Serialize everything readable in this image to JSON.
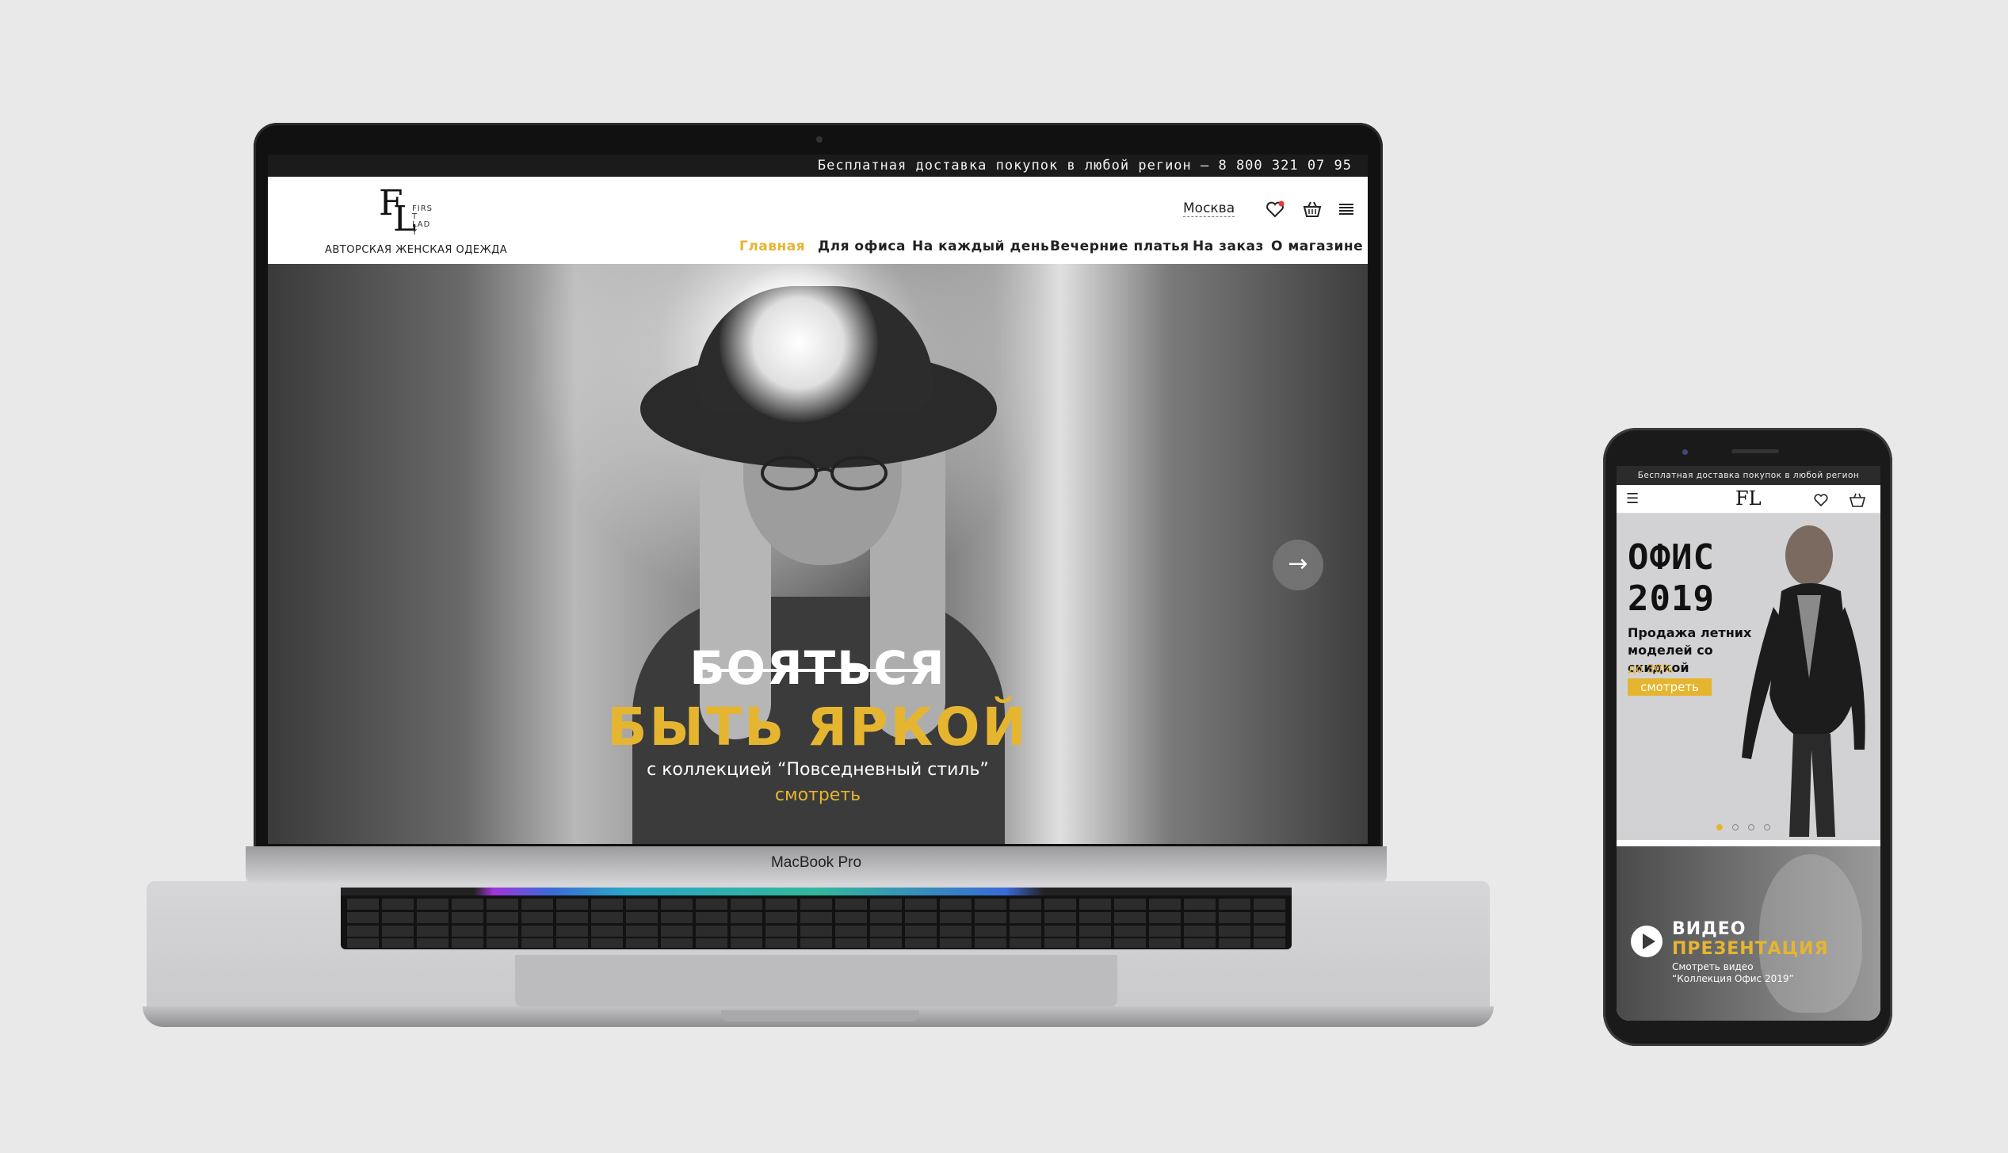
{
  "laptop": {
    "brand_label": "MacBook Pro"
  },
  "site": {
    "topbar_text": "Бесплатная доставка покупок в любой регион – 8 800 321 07 95",
    "logo": {
      "letters_f": "F",
      "letters_l": "L",
      "first_lady": "FIRST LADY"
    },
    "tagline": "АВТОРСКАЯ ЖЕНСКАЯ ОДЕЖДА",
    "city": "Москва",
    "nav": [
      {
        "label": "Главная"
      },
      {
        "label": "Для офиса"
      },
      {
        "label": "На каждый день"
      },
      {
        "label": "Вечерние платья"
      },
      {
        "label": "На заказ"
      },
      {
        "label": "О магазине"
      }
    ],
    "hero": {
      "strike_text": "БОЯТЬСЯ",
      "title": "БЫТЬ ЯРКОЙ",
      "subtitle": "с коллекцией “Повседневный стиль”",
      "link": "смотреть",
      "next_arrow": "→"
    },
    "colors": {
      "accent": "#e6b530",
      "dark": "#1b1b1b"
    }
  },
  "mobile": {
    "topbar_text": "Бесплатная доставка покупок в любой регион",
    "burger": "☰",
    "logo": "FL",
    "banner": {
      "title_line1": "ОФИС",
      "title_line2": "2019",
      "promo": "Продажа летних моделей со скидкой",
      "discount": "до 30%",
      "button": "смотреть",
      "active_slide": 1,
      "slides_count": 4
    },
    "video": {
      "line1": "ВИДЕО",
      "line2": "ПРЕЗЕНТАЦИЯ",
      "caption1": "Смотреть видео",
      "caption2": "“Коллекция Офис 2019”"
    }
  },
  "icons": [
    "heart-icon",
    "basket-icon",
    "menu-icon",
    "arrow-right-icon",
    "play-icon",
    "burger-icon"
  ]
}
